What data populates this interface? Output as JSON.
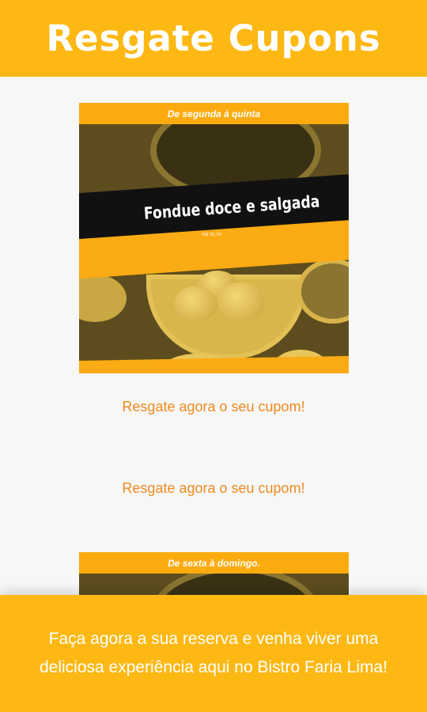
{
  "header": {
    "title": "Resgate Cupons"
  },
  "coupons": [
    {
      "day_range": "De segunda à quinta",
      "title": "Fondue doce e salgada",
      "subtitle": "R$ 00,00"
    },
    {
      "day_range": "De sexta à domingo."
    }
  ],
  "links": [
    {
      "label": "Resgate agora o seu cupom!"
    },
    {
      "label": "Resgate agora o seu cupom!"
    }
  ],
  "footer": {
    "text": "Faça agora a sua reserva e venha viver uma deliciosa experiência aqui no Bistro Faria Lima!"
  },
  "colors": {
    "brand": "#fdb813",
    "accent": "#ef8a1e",
    "background": "#f7f7f8"
  }
}
